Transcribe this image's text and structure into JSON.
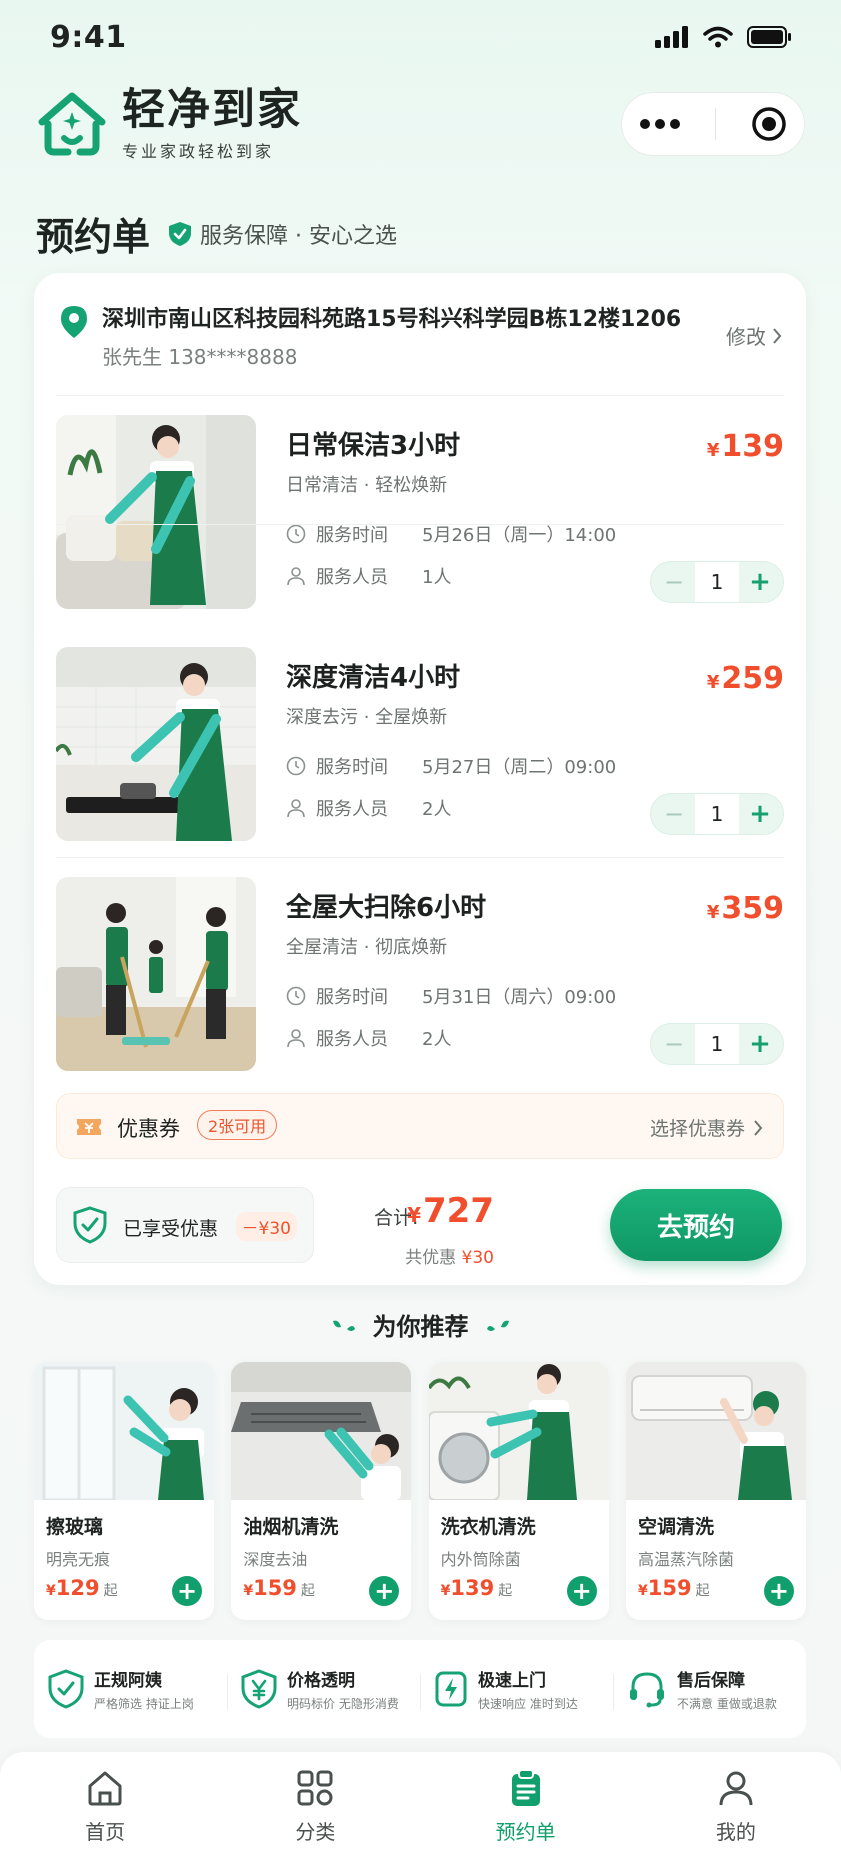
{
  "status_bar": {
    "time": "9:41"
  },
  "header": {
    "brand_name": "轻净到家",
    "brand_slogan": "专业家政轻松到家",
    "more_icon": "ellipsis-icon",
    "close_icon": "target-icon"
  },
  "page": {
    "title": "预约单",
    "guarantee": "服务保障 · 安心之选"
  },
  "address": {
    "line": "深圳市南山区科技园科苑路15号科兴科学园B栋12楼1206",
    "contact": "张先生  138****8888",
    "edit_label": "修改"
  },
  "services": [
    {
      "name": "日常保洁3小时",
      "desc": "日常清洁 · 轻松焕新",
      "time_label": "服务时间",
      "time": "5月26日（周一）14:00",
      "staff_label": "服务人员",
      "staff": "1人",
      "currency": "¥",
      "price": "139",
      "qty": "1"
    },
    {
      "name": "深度清洁4小时",
      "desc": "深度去污 · 全屋焕新",
      "time_label": "服务时间",
      "time": "5月27日（周二）09:00",
      "staff_label": "服务人员",
      "staff": "2人",
      "currency": "¥",
      "price": "259",
      "qty": "1"
    },
    {
      "name": "全屋大扫除6小时",
      "desc": "全屋清洁 · 彻底焕新",
      "time_label": "服务时间",
      "time": "5月31日（周六）09:00",
      "staff_label": "服务人员",
      "staff": "2人",
      "currency": "¥",
      "price": "359",
      "qty": "1"
    }
  ],
  "coupon": {
    "label": "优惠券",
    "badge": "2张可用",
    "pick": "选择优惠券"
  },
  "summary": {
    "enjoyed_label": "已享受优惠",
    "enjoyed_value": "－¥30",
    "total_label": "合计:",
    "currency": "¥",
    "total": "727",
    "discount_label": "共优惠",
    "discount_value": "¥30",
    "book_label": "去预约"
  },
  "recommend": {
    "title": "为你推荐",
    "items": [
      {
        "name": "擦玻璃",
        "desc": "明亮无痕",
        "currency": "¥",
        "price": "129",
        "suffix": "起"
      },
      {
        "name": "油烟机清洗",
        "desc": "深度去油",
        "currency": "¥",
        "price": "159",
        "suffix": "起"
      },
      {
        "name": "洗衣机清洗",
        "desc": "内外筒除菌",
        "currency": "¥",
        "price": "139",
        "suffix": "起"
      },
      {
        "name": "空调清洗",
        "desc": "高温蒸汽除菌",
        "currency": "¥",
        "price": "159",
        "suffix": "起"
      }
    ]
  },
  "features": [
    {
      "title": "正规阿姨",
      "sub": "严格筛选 持证上岗",
      "icon": "shield-check-icon"
    },
    {
      "title": "价格透明",
      "sub": "明码标价 无隐形消费",
      "icon": "yuan-shield-icon"
    },
    {
      "title": "极速上门",
      "sub": "快速响应 准时到达",
      "icon": "lightning-icon"
    },
    {
      "title": "售后保障",
      "sub": "不满意 重做或退款",
      "icon": "headset-icon"
    }
  ],
  "tabbar": [
    {
      "label": "首页",
      "icon": "home-icon"
    },
    {
      "label": "分类",
      "icon": "grid-icon"
    },
    {
      "label": "预约单",
      "icon": "clipboard-icon",
      "active": true
    },
    {
      "label": "我的",
      "icon": "user-icon"
    }
  ],
  "colors": {
    "brand_green": "#11a06d",
    "price_red": "#f04e2c",
    "background": "#eef8f3"
  }
}
